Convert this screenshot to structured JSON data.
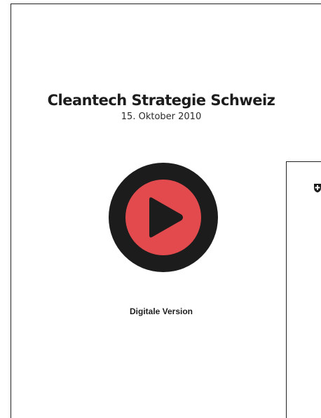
{
  "cover": {
    "title": "Cleantech Strategie Schweiz",
    "date": "15. Oktober 2010",
    "caption": "Digitale Version",
    "play_icon": "play-icon"
  },
  "colors": {
    "outer_ring": "#1c1c1c",
    "inner_circle": "#e24a4d",
    "play_triangle": "#1c1c1c",
    "background": "#ffffff"
  },
  "back_page": {
    "emblem_icon": "swiss-cross-shield-icon"
  }
}
